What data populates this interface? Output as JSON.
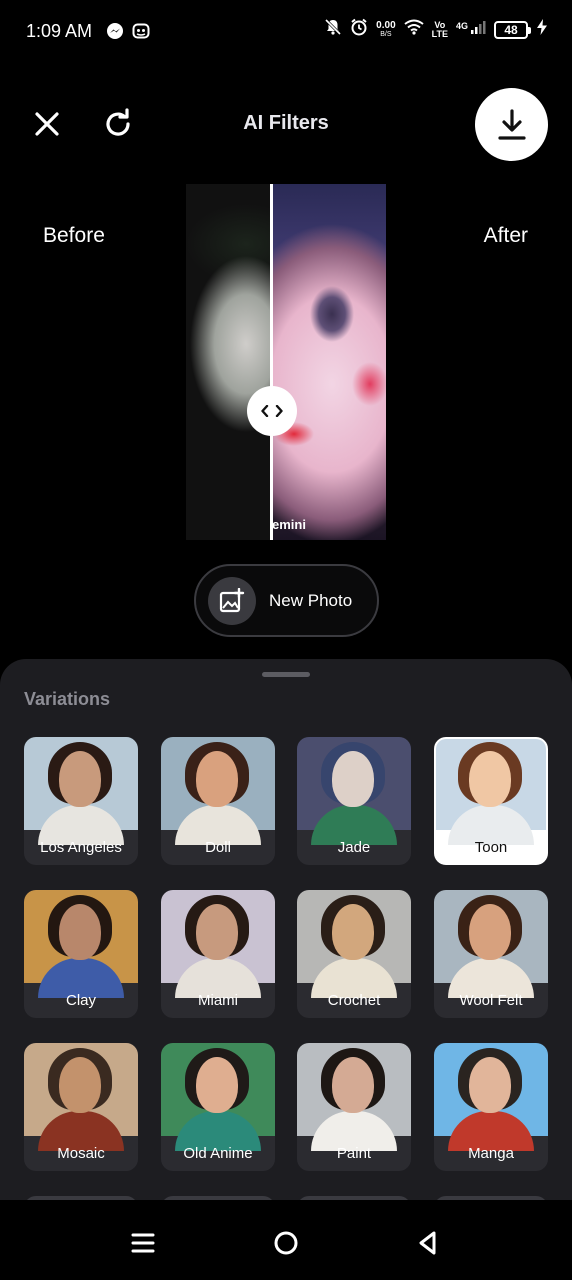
{
  "status_bar": {
    "time": "1:09 AM",
    "net_speed": "0.00",
    "net_unit": "B/S",
    "volte_top": "Vo",
    "volte_bottom": "LTE",
    "network": "4G",
    "battery": "48"
  },
  "header": {
    "title": "AI Filters",
    "close_icon": "close-icon",
    "refresh_icon": "refresh-icon",
    "download_icon": "download-icon"
  },
  "compare": {
    "before_label": "Before",
    "after_label": "After",
    "watermark": "emini",
    "divider_position": 0.43
  },
  "new_photo": {
    "label": "New Photo",
    "icon": "add-photo-icon"
  },
  "sheet": {
    "title": "Variations",
    "selected": "Toon",
    "items": [
      {
        "label": "Los Angeles",
        "bg": "#b7c9d6",
        "hair": "#2a1a14",
        "skin": "#c89a7c",
        "body": "#e7e5e0"
      },
      {
        "label": "Doll",
        "bg": "#9ab0bf",
        "hair": "#3a2118",
        "skin": "#d9a17e",
        "body": "#e8e4dc"
      },
      {
        "label": "Jade",
        "bg": "#4b4e6e",
        "hair": "#37456d",
        "skin": "#ddd0c8",
        "body": "#2f7c56"
      },
      {
        "label": "Toon",
        "bg": "#c8d8e6",
        "hair": "#6a3a22",
        "skin": "#f0c7a4",
        "body": "#e9ecee"
      },
      {
        "label": "Clay",
        "bg": "#c89448",
        "hair": "#231711",
        "skin": "#b8876b",
        "body": "#3e5ca8"
      },
      {
        "label": "Miami",
        "bg": "#c9c2d2",
        "hair": "#261a14",
        "skin": "#c79a7e",
        "body": "#e6e1da"
      },
      {
        "label": "Crochet",
        "bg": "#b7b7b5",
        "hair": "#2a1e17",
        "skin": "#d2a77d",
        "body": "#e9e2d3"
      },
      {
        "label": "Wool Felt",
        "bg": "#a9b6c0",
        "hair": "#3a2216",
        "skin": "#d7a17e",
        "body": "#ece5da"
      },
      {
        "label": "Mosaic",
        "bg": "#c6a98a",
        "hair": "#3a2a20",
        "skin": "#c3926c",
        "body": "#8a3322"
      },
      {
        "label": "Old Anime",
        "bg": "#3f8a5a",
        "hair": "#1f1a18",
        "skin": "#dfae90",
        "body": "#2b8a7a"
      },
      {
        "label": "Paint",
        "bg": "#b9bdc1",
        "hair": "#1d1714",
        "skin": "#d4aa94",
        "body": "#f0eeea"
      },
      {
        "label": "Manga",
        "bg": "#6fb6e6",
        "hair": "#2a2420",
        "skin": "#e1b59a",
        "body": "#c0392b"
      }
    ]
  },
  "nav": {
    "menu_icon": "menu-icon",
    "home_icon": "home-icon",
    "back_icon": "back-icon"
  }
}
